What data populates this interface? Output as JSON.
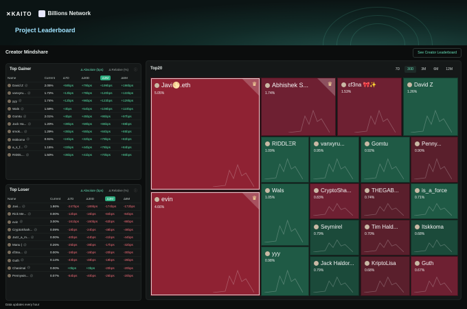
{
  "header": {
    "brand": "KAITO",
    "partner": "Billions Network",
    "title": "Project Leaderboard"
  },
  "section_title": "Creator Mindshare",
  "see_button": "See Creator Leaderboard",
  "gainer": {
    "title": "Top Gainer",
    "toggle_abs": "Δ Absolute (bps)",
    "toggle_rel": "Δ Relative (%)",
    "columns": [
      "Name",
      "Current",
      "Δ7D",
      "Δ30D",
      "Δ3M",
      "Δ6M"
    ],
    "rows": [
      {
        "name": "David Z",
        "handle": "@",
        "current": "2.05%",
        "d7": "+59bps",
        "d30": "+79bps",
        "d3m": "+199bps",
        "d6m": "+198bps"
      },
      {
        "name": "vanxyru...",
        "handle": "@",
        "current": "1.72%",
        "d7": "+13bps",
        "d30": "+78bps",
        "d3m": "+120bps",
        "d6m": "+133bps"
      },
      {
        "name": "yyy",
        "handle": "@",
        "current": "1.74%",
        "d7": "+12bps",
        "d30": "+96bps",
        "d3m": "+123bps",
        "d6m": "+129bps"
      },
      {
        "name": "Wals",
        "handle": "@",
        "current": "1.59%",
        "d7": "+3bps",
        "d30": "+54bps",
        "d3m": "+108bps",
        "d6m": "+110bps"
      },
      {
        "name": "Gomtu",
        "handle": "@",
        "current": "2.01%",
        "d7": "+4bps",
        "d30": "+45bps",
        "d3m": "+95bps",
        "d6m": "+97bps"
      },
      {
        "name": "Jack Ha...",
        "handle": "@",
        "current": "1.20%",
        "d7": "+39bps",
        "d30": "+59bps",
        "d3m": "+86bps",
        "d6m": "+88bps"
      },
      {
        "name": "smok...",
        "handle": "@",
        "current": "1.29%",
        "d7": "+35bps",
        "d30": "+55bps",
        "d3m": "+84bps",
        "d6m": "+85bps"
      },
      {
        "name": "Itskkoma",
        "handle": "@",
        "current": "0.91%",
        "d7": "+24bps",
        "d30": "+32bps",
        "d3m": "+79bps",
        "d6m": "+82bps"
      },
      {
        "name": "a_s_f...",
        "handle": "@",
        "current": "1.15%",
        "d7": "+33bps",
        "d30": "+44bps",
        "d3m": "+76bps",
        "d6m": "+84bps"
      },
      {
        "name": "RIDDL...",
        "handle": "@",
        "current": "1.50%",
        "d7": "+35bps",
        "d30": "+41bps",
        "d3m": "+70bps",
        "d6m": "+80bps"
      }
    ]
  },
  "loser": {
    "title": "Top Loser",
    "toggle_abs": "Δ Absolute (bps)",
    "toggle_rel": "Δ Relative (%)",
    "columns": [
      "Name",
      "Current",
      "Δ7D",
      "Δ30D",
      "Δ3M",
      "Δ6M"
    ],
    "rows": [
      {
        "name": "Javi...",
        "handle": "@",
        "current": "1.86%",
        "d7": "-247bps",
        "d30": "-189bps",
        "d3m": "-174bps",
        "d6m": "-172bps"
      },
      {
        "name": "Rick Me...",
        "handle": "@",
        "current": "0.00%",
        "d7": "-12bps",
        "d30": "-16bps",
        "d3m": "-84bps",
        "d6m": "-84bps"
      },
      {
        "name": "evin",
        "handle": "@",
        "current": "3.00%",
        "d7": "-161bps",
        "d30": "-160bps",
        "d3m": "-63bps",
        "d6m": "-88bps"
      },
      {
        "name": "CryptoShark...",
        "handle": "@",
        "current": "0.09%",
        "d7": "-18bps",
        "d30": "-24bps",
        "d3m": "-48bps",
        "d6m": "-49bps"
      },
      {
        "name": "Jazz_a_m...",
        "handle": "@",
        "current": "0.00%",
        "d7": "-40bps",
        "d30": "-44bps",
        "d3m": "-41bps",
        "d6m": "-44bps"
      },
      {
        "name": "Manu |",
        "handle": "@",
        "current": "0.26%",
        "d7": "-25bps",
        "d30": "-38bps",
        "d3m": "-17bps",
        "d6m": "-32bps"
      },
      {
        "name": "εf3na...",
        "handle": "@",
        "current": "0.00%",
        "d7": "-16bps",
        "d30": "-16bps",
        "d3m": "-20bps",
        "d6m": "-30bps"
      },
      {
        "name": "Guth",
        "handle": "@",
        "current": "0.14%",
        "d7": "-43bps",
        "d30": "-48bps",
        "d3m": "-19bps",
        "d6m": "-28bps"
      },
      {
        "name": "Chanimal",
        "handle": "@",
        "current": "0.00%",
        "d7": "+0bps",
        "d30": "+0bps",
        "d3m": "-20bps",
        "d6m": "-20bps"
      },
      {
        "name": "Pennywis...",
        "handle": "@",
        "current": "0.07%",
        "d7": "-54bps",
        "d30": "-40bps",
        "d3m": "-25bps",
        "d6m": "-20bps"
      }
    ]
  },
  "treemap": {
    "title": "Top20",
    "ranges": [
      "7D",
      "30D",
      "3M",
      "6M",
      "12M"
    ],
    "active_range": "30D",
    "tiles": [
      {
        "name": "Javi🌕.eth",
        "pct": "5.05%",
        "color": "red"
      },
      {
        "name": "evin",
        "pct": "4.66%",
        "color": "red"
      },
      {
        "name": "Abhishek S...",
        "pct": "1.74%",
        "color": "red2"
      },
      {
        "name": "ɛf3na 🎀✨",
        "pct": "1.53%",
        "color": "red2"
      },
      {
        "name": "David Z",
        "pct": "1.26%",
        "color": "green"
      },
      {
        "name": "RIDDLΞR",
        "pct": "1.09%",
        "color": "green"
      },
      {
        "name": "vanxyru...",
        "pct": "0.95%",
        "color": "green"
      },
      {
        "name": "Gomtu",
        "pct": "0.92%",
        "color": "green"
      },
      {
        "name": "Penny...",
        "pct": "0.90%",
        "color": "red3"
      },
      {
        "name": "Wals",
        "pct": "1.05%",
        "color": "green"
      },
      {
        "name": "CryptoSha...",
        "pct": "0.83%",
        "color": "red2"
      },
      {
        "name": "THEGAB...",
        "pct": "0.74%",
        "color": "red3"
      },
      {
        "name": "is_a_force",
        "pct": "0.71%",
        "color": "green"
      },
      {
        "name": "Seymirel",
        "pct": "0.79%",
        "color": "green2"
      },
      {
        "name": "Tim Hald...",
        "pct": "0.70%",
        "color": "red3"
      },
      {
        "name": "Itskkoma",
        "pct": "0.68%",
        "color": "green2"
      },
      {
        "name": "yyy",
        "pct": "0.98%",
        "color": "green"
      },
      {
        "name": "Jack Haldor...",
        "pct": "0.79%",
        "color": "green2"
      },
      {
        "name": "KriptoLisa",
        "pct": "0.68%",
        "color": "red3"
      },
      {
        "name": "Guth",
        "pct": "0.67%",
        "color": "red2"
      }
    ]
  },
  "footer": "Data updates every hour",
  "colors": {
    "accent": "#66e0b8",
    "positive": "#56e0a6",
    "negative": "#f36b78"
  }
}
